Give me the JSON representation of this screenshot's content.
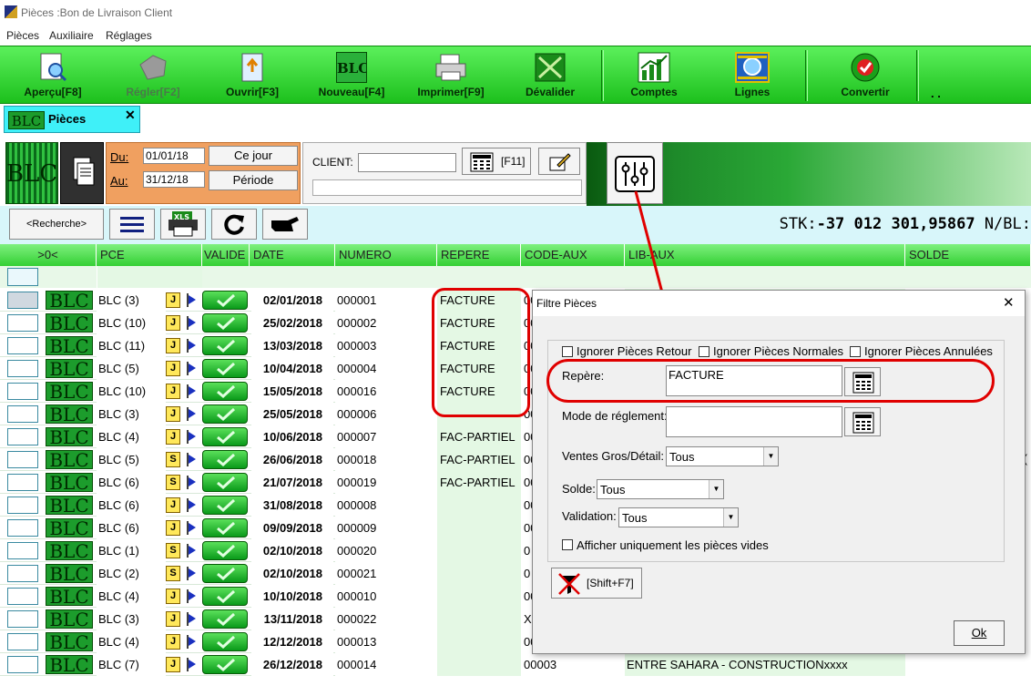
{
  "window": {
    "title": "Pièces :Bon de Livraison Client"
  },
  "menu": [
    "Pièces",
    "Auxiliaire",
    "Réglages"
  ],
  "toolbar": {
    "buttons": [
      {
        "label": "Aperçu[F8]",
        "icon": "preview-icon"
      },
      {
        "label": "Régler[F2]",
        "icon": "payment-icon",
        "disabled": true
      },
      {
        "label": "Ouvrir[F3]",
        "icon": "open-icon"
      },
      {
        "label": "Nouveau[F4]",
        "icon": "blc-new-icon"
      },
      {
        "label": "Imprimer[F9]",
        "icon": "printer-icon"
      },
      {
        "label": "Dévalider",
        "icon": "invalidate-icon"
      },
      {
        "label": "Comptes",
        "icon": "chart-icon"
      },
      {
        "label": "Lignes",
        "icon": "lines-icon"
      },
      {
        "label": "Convertir",
        "icon": "convert-icon"
      }
    ],
    "overflow": ". ."
  },
  "tab": {
    "label": "Pièces",
    "close": "✕",
    "logo": "BLC"
  },
  "dates": {
    "du_label": "Du:",
    "du_value": "01/01/18",
    "au_label": "Au:",
    "au_value": "31/12/18",
    "ce_jour": "Ce jour",
    "periode": "Période"
  },
  "client": {
    "label": "CLIENT:",
    "value": "",
    "f11": "[F11]"
  },
  "logo_text": "BLC",
  "search": {
    "label": "<Recherche>",
    "xls": "XLS"
  },
  "stk": {
    "prefix": "STK:",
    "value": "-37 012 301,95867",
    "suffix": " N/BL:"
  },
  "grid": {
    "headers": [
      ">0<",
      "PCE",
      "VALIDE",
      "DATE",
      "NUMERO",
      "REPERE",
      "CODE-AUX",
      "LIB-AUX",
      "SOLDE"
    ],
    "rows": [
      {
        "pce": "BLC (3)",
        "icon": "J",
        "date": "02/01/2018",
        "numero": "000001",
        "repere": "FACTURE",
        "code": "00",
        "lib": ""
      },
      {
        "pce": "BLC (10)",
        "icon": "J",
        "date": "25/02/2018",
        "numero": "000002",
        "repere": "FACTURE",
        "code": "00",
        "lib": ""
      },
      {
        "pce": "BLC (11)",
        "icon": "J",
        "date": "13/03/2018",
        "numero": "000003",
        "repere": "FACTURE",
        "code": "00",
        "lib": ""
      },
      {
        "pce": "BLC (5)",
        "icon": "J",
        "date": "10/04/2018",
        "numero": "000004",
        "repere": "FACTURE",
        "code": "00",
        "lib": ""
      },
      {
        "pce": "BLC (10)",
        "icon": "J",
        "date": "15/05/2018",
        "numero": "000016",
        "repere": "FACTURE",
        "code": "00",
        "lib": ""
      },
      {
        "pce": "BLC (3)",
        "icon": "J",
        "date": "25/05/2018",
        "numero": "000006",
        "repere": "",
        "code": "00",
        "lib": ""
      },
      {
        "pce": "BLC (4)",
        "icon": "J",
        "date": "10/06/2018",
        "numero": "000007",
        "repere": "FAC-PARTIEL",
        "code": "00",
        "lib": ""
      },
      {
        "pce": "BLC (5)",
        "icon": "S",
        "date": "26/06/2018",
        "numero": "000018",
        "repere": "FAC-PARTIEL",
        "code": "00",
        "lib": ""
      },
      {
        "pce": "BLC (6)",
        "icon": "S",
        "date": "21/07/2018",
        "numero": "000019",
        "repere": "FAC-PARTIEL",
        "code": "00",
        "lib": ""
      },
      {
        "pce": "BLC (6)",
        "icon": "J",
        "date": "31/08/2018",
        "numero": "000008",
        "repere": "",
        "code": "00",
        "lib": ""
      },
      {
        "pce": "BLC (6)",
        "icon": "J",
        "date": "09/09/2018",
        "numero": "000009",
        "repere": "",
        "code": "00",
        "lib": ""
      },
      {
        "pce": "BLC (1)",
        "icon": "S",
        "date": "02/10/2018",
        "numero": "000020",
        "repere": "",
        "code": "0",
        "lib": ""
      },
      {
        "pce": "BLC (2)",
        "icon": "S",
        "date": "02/10/2018",
        "numero": "000021",
        "repere": "",
        "code": "0",
        "lib": ""
      },
      {
        "pce": "BLC (4)",
        "icon": "J",
        "date": "10/10/2018",
        "numero": "000010",
        "repere": "",
        "code": "00",
        "lib": ""
      },
      {
        "pce": "BLC (3)",
        "icon": "J",
        "date": "13/11/2018",
        "numero": "000022",
        "repere": "",
        "code": "X",
        "lib": ""
      },
      {
        "pce": "BLC (4)",
        "icon": "J",
        "date": "12/12/2018",
        "numero": "000013",
        "repere": "",
        "code": "00",
        "lib": ""
      },
      {
        "pce": "BLC (7)",
        "icon": "J",
        "date": "26/12/2018",
        "numero": "000014",
        "repere": "",
        "code": "00003",
        "lib": "ENTRE SAHARA - CONSTRUCTIONxxxx"
      }
    ],
    "edge_text": ",("
  },
  "dialog": {
    "title": "Filtre Pièces",
    "close": "✕",
    "ignore_retour": "Ignorer Pièces Retour",
    "ignore_normales": "Ignorer Pièces Normales",
    "ignore_annulees": "Ignorer Pièces Annulées",
    "repere_label": "Repère:",
    "repere_value": "FACTURE",
    "mode_label": "Mode de réglement:",
    "mode_value": "",
    "ventes_label": "Ventes Gros/Détail:",
    "ventes_value": "Tous",
    "solde_label": "Solde:",
    "solde_value": "Tous",
    "validation_label": "Validation:",
    "validation_value": "Tous",
    "vides_label": "Afficher uniquement les pièces vides",
    "reset_label": "[Shift+F7]",
    "ok_label": "Ok"
  },
  "colors": {
    "toolbar_green": "#22c822",
    "annotation_red": "#e00000",
    "tab_cyan": "#3ff0f8",
    "date_panel": "#f0a060"
  }
}
